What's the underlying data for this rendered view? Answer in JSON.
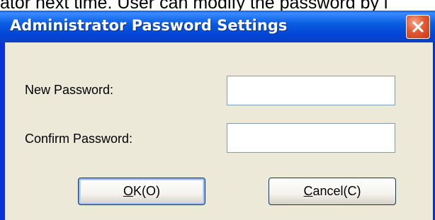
{
  "background_text": "ator next time. User can modify the password by i",
  "dialog": {
    "title": "Administrator Password Settings",
    "close_icon": "close-icon"
  },
  "form": {
    "new_password": {
      "label": "New Password:",
      "value": "",
      "placeholder": ""
    },
    "confirm_password": {
      "label": "Confirm Password:",
      "value": "",
      "placeholder": ""
    }
  },
  "buttons": {
    "ok": {
      "mnemonic": "O",
      "rest": "K(O)"
    },
    "cancel": {
      "mnemonic": "C",
      "rest": "ancel(C)"
    }
  },
  "colors": {
    "titlebar": "#0a5ee0",
    "client": "#ece9d8",
    "close": "#e25a34",
    "button_border": "#003c74",
    "field_border": "#7f9db9"
  }
}
